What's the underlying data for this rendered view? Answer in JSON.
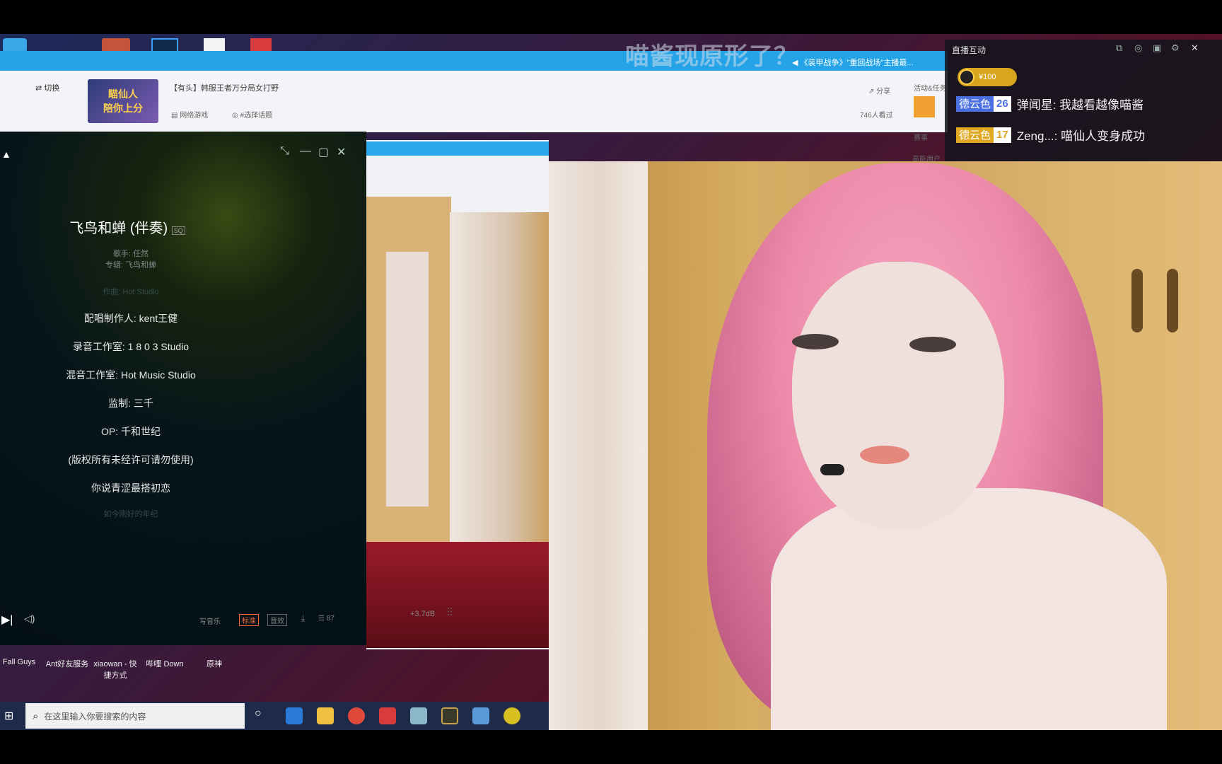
{
  "browser": {
    "switch_label": "切换",
    "room_title": "【有头】韩服王者万分局女打野",
    "category": "网络游戏",
    "topic": "#选择话题",
    "share_label": "分享",
    "viewer_count": "746人看过",
    "banner_text": "瞄仙人\n陪你上分",
    "side_label": "活动&任务",
    "side_label2": "赛事",
    "side_label3": "高能用户"
  },
  "overlay": {
    "title": "喵酱现原形了？",
    "marquee": "《装甲战争》\"重回战场\"主播最..."
  },
  "chat": {
    "header": "直播互动",
    "gift_amount": "¥100",
    "messages": [
      {
        "badge": "德云色",
        "level": "26",
        "badge_color": "#4a6fe0",
        "text": "弹闻星: 我越看越像喵酱"
      },
      {
        "badge": "德云色",
        "level": "17",
        "badge_color": "#e0a820",
        "text": "Zeng...: 喵仙人变身成功"
      }
    ]
  },
  "player": {
    "song_title": "飞鸟和蝉 (伴奏)",
    "singer": "歌手: 任然",
    "album": "专辑: 飞鸟和蝉",
    "lyrics_faded_top": "作曲: Hot Studio",
    "lyrics": [
      "配唱制作人: kent王健",
      "录音工作室: 1 8 0 3 Studio",
      "混音工作室: Hot Music Studio",
      "监制: 三千",
      "OP: 千和世纪",
      "(版权所有未经许可请勿使用)",
      "你说青涩最搭初恋"
    ],
    "lyrics_faded_bottom": "如今刚好的年纪",
    "controls": {
      "lyric_btn": "写音乐",
      "quality": "标准",
      "effect": "音效",
      "count": "87"
    }
  },
  "nested": {
    "db_label": "+3.7dB"
  },
  "desktop_icons": [
    "Fall Guys",
    "Ant好友服务",
    "xiaowan - 快捷方式",
    "哔哩 Down",
    "原神"
  ],
  "taskbar": {
    "search_placeholder": "在这里输入你要搜索的内容"
  }
}
